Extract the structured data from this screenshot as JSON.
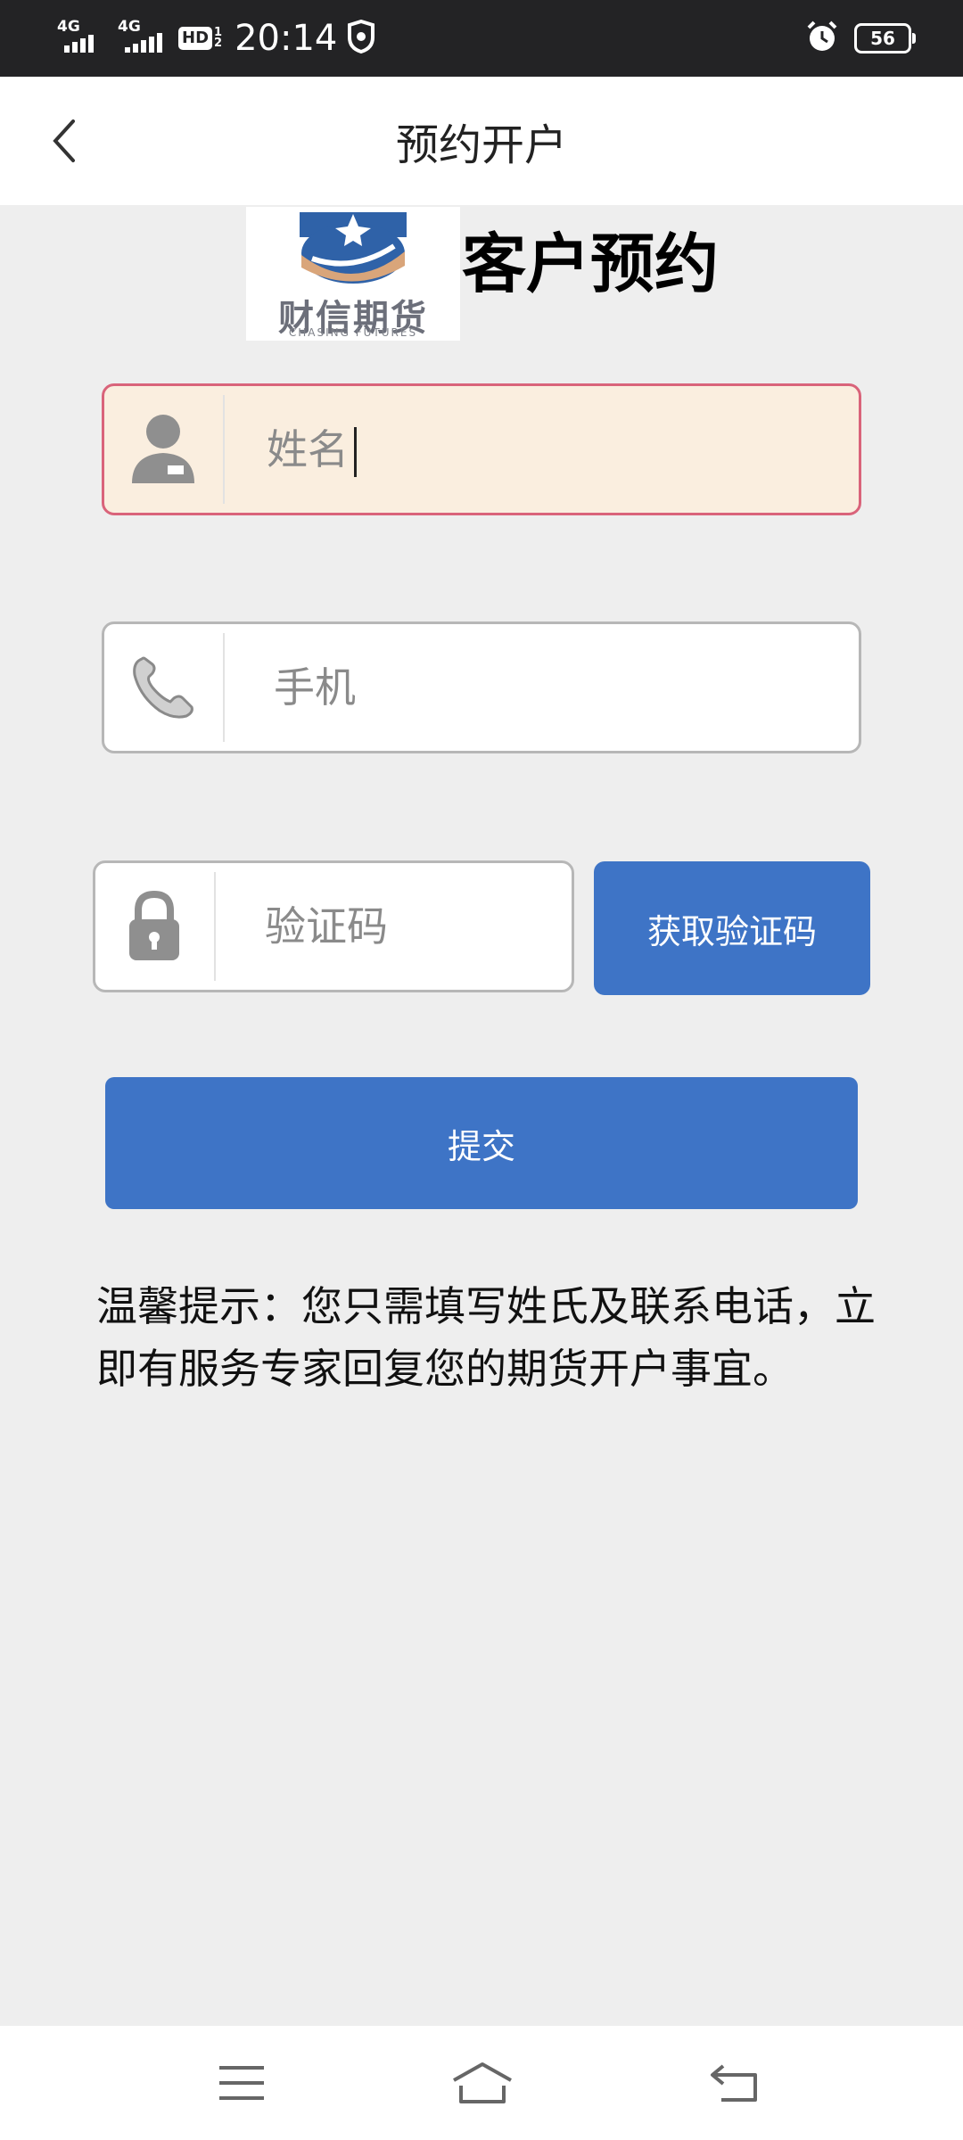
{
  "status_bar": {
    "network_1": "4G",
    "network_2": "4G",
    "hd_label": "HD",
    "hd_sim_top": "1",
    "hd_sim_bottom": "2",
    "time": "20:14",
    "battery_level": "56"
  },
  "nav": {
    "title": "预约开户",
    "back_icon": "chevron-left-icon"
  },
  "header": {
    "logo_cn": "财信期货",
    "logo_en": "CHASING FUTURES",
    "heading": "客户预约"
  },
  "form": {
    "name_placeholder": "姓名",
    "name_value": "",
    "phone_placeholder": "手机",
    "phone_value": "",
    "code_placeholder": "验证码",
    "code_value": "",
    "get_code_label": "获取验证码",
    "submit_label": "提交"
  },
  "tip": {
    "text": "温馨提示：您只需填写姓氏及联系电话，立即有服务专家回复您的期货开户事宜。"
  },
  "colors": {
    "primary": "#3e74c6",
    "status_bar_bg": "#232325",
    "page_bg": "#eeeeee",
    "focused_field_bg": "#faeedf",
    "focused_field_border": "#d9637a"
  }
}
